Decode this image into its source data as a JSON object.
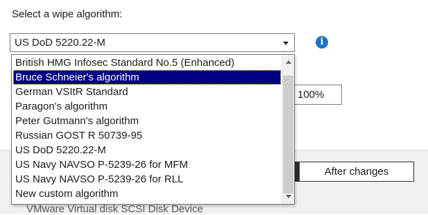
{
  "wipe_dialog": {
    "prompt_label": "Select a wipe algorithm:",
    "selected_algorithm": "US DoD 5220.22-M",
    "algorithm_options": [
      "British HMG Infosec Standard No.5 (Enhanced)",
      "Bruce Schneier's algorithm",
      "German VSItR Standard",
      "Paragon's algorithm",
      "Peter Gutmann's algorithm",
      "Russian GOST R 50739-95",
      "US DoD 5220.22-M",
      "US Navy NAVSO P-5239-26 for MFM",
      "US Navy NAVSO P-5239-26 for RLL",
      "New custom algorithm"
    ],
    "highlighted_option_index": 1,
    "percent_value": "100%",
    "after_changes_label": "After changes",
    "device_text": "VMware Virtual disk SCSI Disk Device",
    "icons": {
      "info": "info-icon",
      "dropdown": "chevron-down-icon"
    },
    "colors": {
      "highlight": "#000080",
      "info": "#1e73be"
    }
  }
}
